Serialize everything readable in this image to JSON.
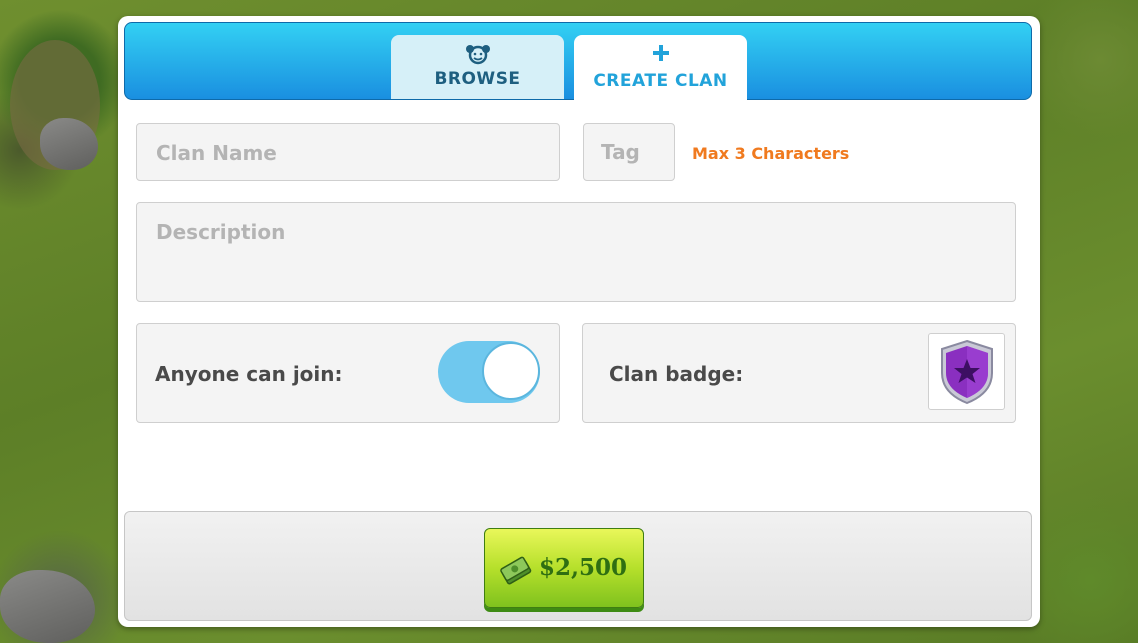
{
  "tabs": {
    "browse": {
      "label": "BROWSE",
      "icon": "friends-icon"
    },
    "create": {
      "label": "CREATE CLAN",
      "icon": "plus-icon"
    }
  },
  "form": {
    "name_placeholder": "Clan Name",
    "tag_placeholder": "Tag",
    "tag_hint": "Max 3 Characters",
    "description_placeholder": "Description",
    "join_label": "Anyone can join:",
    "join_toggle_on": true,
    "badge_label": "Clan badge:",
    "badge_icon": "purple-star-shield-icon"
  },
  "purchase": {
    "price": "$2,500",
    "icon": "cash-stack-icon"
  },
  "colors": {
    "header_blue": "#33d0f3",
    "accent_orange": "#f07a1f",
    "button_green": "#b6e02b",
    "badge_purple": "#7b2ba8"
  }
}
